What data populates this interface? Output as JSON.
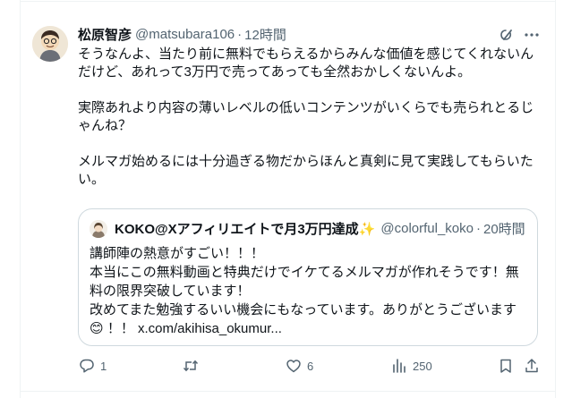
{
  "tweet": {
    "author": {
      "display_name": "松原智彦",
      "handle": "@matsubara106",
      "separator": "·",
      "time": "12時間"
    },
    "body": {
      "paragraph_1": "そうなんよ、当たり前に無料でもらえるからみんな価値を感じてくれないんだけど、あれって3万円で売ってあっても全然おかしくないんよ。",
      "paragraph_2": "実際あれより内容の薄いレベルの低いコンテンツがいくらでも売られとるじゃんね？",
      "paragraph_3": "メルマガ始めるには十分過ぎる物だからほんと真剣に見て実践してもらいたい。"
    },
    "quoted": {
      "display_name": "KOKO@Xアフィリエイトで月3万円達成",
      "name_emoji": "✨",
      "handle": "@colorful_koko",
      "separator": "·",
      "time": "20時間",
      "line_1": "講師陣の熱意がすごい！！！",
      "line_2": "本当にこの無料動画と特典だけでイケてるメルマガが作れそうです！無料の限界突破しています！",
      "line_3_text": "改めてまた勉強するいい機会にもなっています。ありがとうございます",
      "line_4_emoji": "😊",
      "line_4_text": "！！",
      "link": "x.com/akihisa_okumur..."
    },
    "actions": {
      "reply_count": "1",
      "retweet_count": "",
      "like_count": "6",
      "views_count": "250"
    },
    "icons": {
      "grok": "grok-icon",
      "more": "more-dots-icon",
      "reply": "reply-icon",
      "retweet": "retweet-icon",
      "like": "heart-icon",
      "views": "views-bar-chart-icon",
      "bookmark": "bookmark-icon",
      "share": "share-icon"
    },
    "colors": {
      "text": "#0f1419",
      "secondary": "#536471",
      "border": "#cfd9de"
    }
  }
}
